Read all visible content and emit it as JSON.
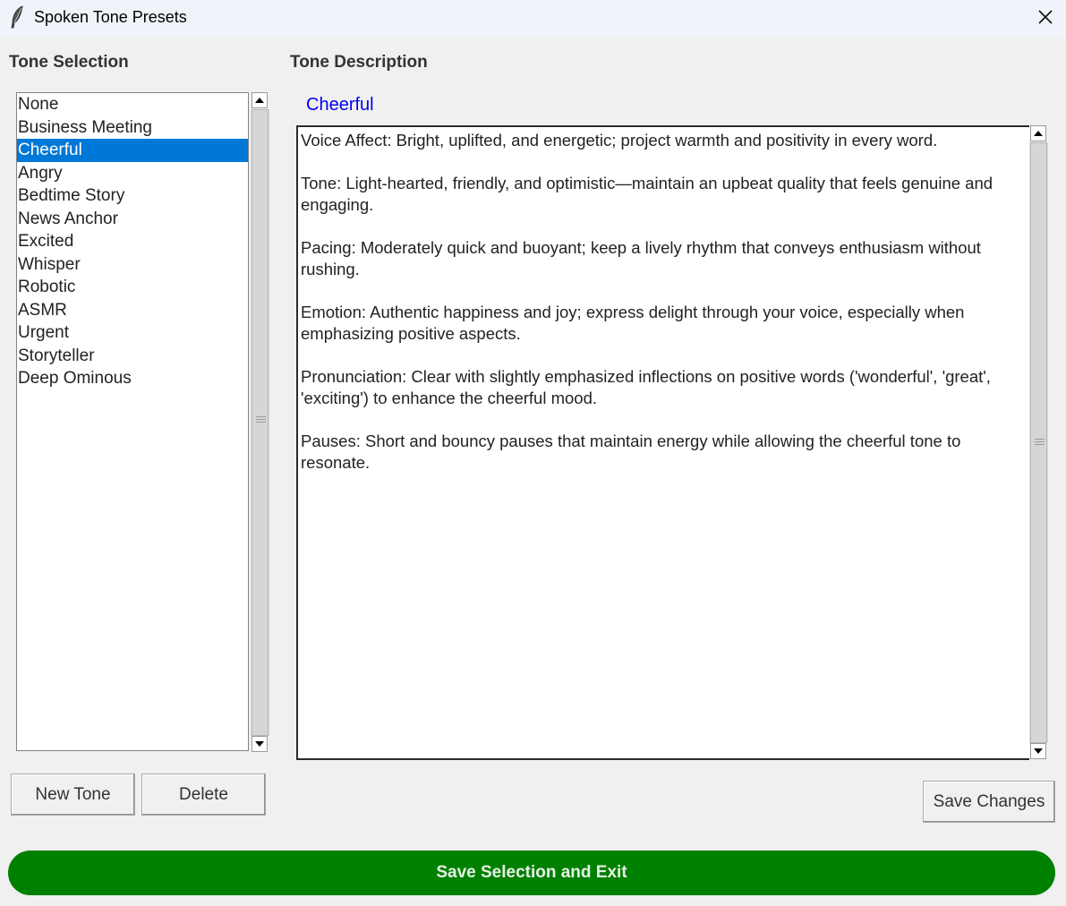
{
  "window": {
    "title": "Spoken Tone Presets",
    "app_icon": "feather-icon",
    "close_icon": "close-icon"
  },
  "left_panel": {
    "heading": "Tone Selection",
    "tones": [
      "None",
      "Business Meeting",
      "Cheerful",
      "Angry",
      "Bedtime Story",
      "News Anchor",
      "Excited",
      "Whisper",
      "Robotic",
      "ASMR",
      "Urgent",
      "Storyteller",
      "Deep Ominous"
    ],
    "selected_index": 2,
    "new_tone_label": "New Tone",
    "delete_label": "Delete"
  },
  "right_panel": {
    "heading": "Tone Description",
    "tone_name": "Cheerful",
    "description": "Voice Affect: Bright, uplifted, and energetic; project warmth and positivity in every word.\n\nTone: Light-hearted, friendly, and optimistic—maintain an upbeat quality that feels genuine and engaging.\n\nPacing: Moderately quick and buoyant; keep a lively rhythm that conveys enthusiasm without rushing.\n\nEmotion: Authentic happiness and joy; express delight through your voice, especially when emphasizing positive aspects.\n\nPronunciation: Clear with slightly emphasized inflections on positive words ('wonderful', 'great', 'exciting') to enhance the cheerful mood.\n\nPauses: Short and bouncy pauses that maintain energy while allowing the cheerful tone to resonate.",
    "save_changes_label": "Save Changes"
  },
  "footer": {
    "save_exit_label": "Save Selection and Exit",
    "save_exit_color": "#008000"
  },
  "colors": {
    "selection": "#0078d7",
    "tone_name": "#0000ee"
  }
}
